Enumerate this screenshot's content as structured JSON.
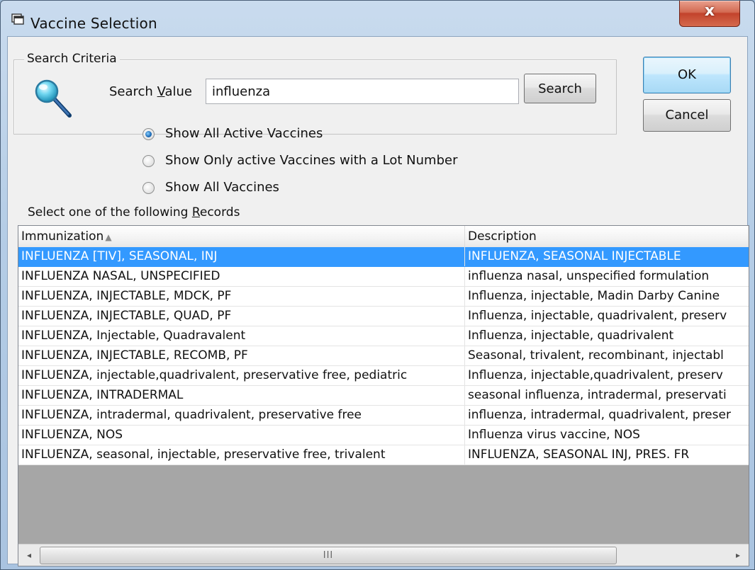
{
  "window": {
    "title": "Vaccine Selection",
    "close_label": "x"
  },
  "search": {
    "group_label": "Search Criteria",
    "label_prefix": "Search ",
    "label_underline": "V",
    "label_suffix": "alue",
    "value": "influenza",
    "button_label": "Search"
  },
  "buttons": {
    "ok_label": "OK",
    "cancel_label": "Cancel"
  },
  "filter": {
    "options": [
      {
        "label": "Show All Active Vaccines",
        "checked": true
      },
      {
        "label": "Show Only active Vaccines with a Lot Number",
        "checked": false
      },
      {
        "label": "Show All Vaccines",
        "checked": false
      }
    ]
  },
  "records": {
    "label_prefix": "Select one of the following ",
    "label_underline": "R",
    "label_suffix": "ecords",
    "columns": [
      "Immunization",
      "Description"
    ],
    "sort_indicator": "▲",
    "rows": [
      {
        "immunization": "INFLUENZA [TIV], SEASONAL, INJ",
        "description": "INFLUENZA, SEASONAL INJECTABLE",
        "selected": true
      },
      {
        "immunization": "INFLUENZA NASAL, UNSPECIFIED",
        "description": "influenza nasal, unspecified formulation"
      },
      {
        "immunization": "INFLUENZA, INJECTABLE, MDCK, PF",
        "description": "Influenza, injectable, Madin Darby Canine"
      },
      {
        "immunization": "INFLUENZA, INJECTABLE, QUAD, PF",
        "description": "Influenza, injectable, quadrivalent, preserv"
      },
      {
        "immunization": "INFLUENZA, Injectable, Quadravalent",
        "description": "Influenza, injectable, quadrivalent"
      },
      {
        "immunization": "INFLUENZA, INJECTABLE, RECOMB, PF",
        "description": "Seasonal, trivalent, recombinant, injectabl"
      },
      {
        "immunization": "INFLUENZA, injectable,quadrivalent, preservative free, pediatric",
        "description": "Influenza, injectable,quadrivalent, preserv"
      },
      {
        "immunization": "INFLUENZA, INTRADERMAL",
        "description": "seasonal influenza, intradermal, preservati"
      },
      {
        "immunization": "INFLUENZA, intradermal, quadrivalent, preservative free",
        "description": "influenza, intradermal, quadrivalent, preser"
      },
      {
        "immunization": "INFLUENZA, NOS",
        "description": "Influenza virus vaccine, NOS"
      },
      {
        "immunization": "INFLUENZA, seasonal, injectable, preservative free, trivalent",
        "description": "INFLUENZA, SEASONAL INJ, PRES. FR"
      }
    ]
  },
  "scrollbar": {
    "left_arrow": "◂",
    "right_arrow": "▸",
    "grip": "III"
  },
  "colors": {
    "selection": "#3399ff",
    "title_gradient": "#b5cde6",
    "close_button": "#c2432c"
  }
}
